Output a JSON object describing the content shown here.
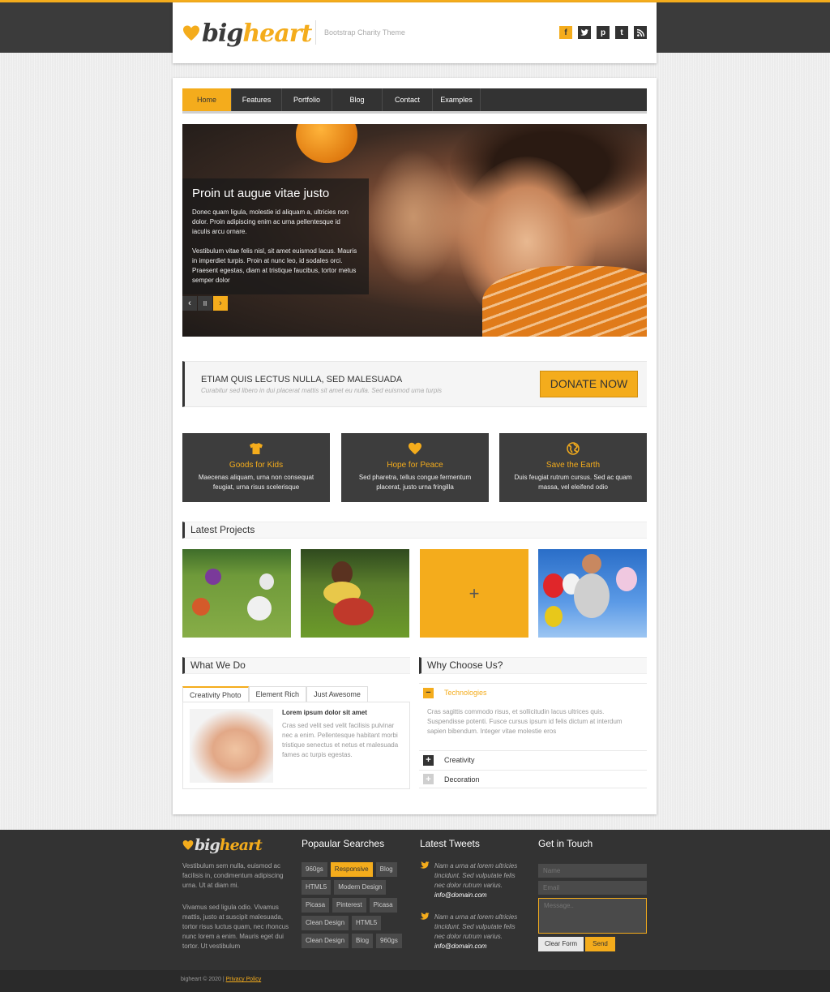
{
  "header": {
    "logo_big": "big",
    "logo_heart": "heart",
    "tagline": "Bootstrap Charity Theme",
    "social": [
      {
        "icon": "facebook-icon",
        "glyph": "f"
      },
      {
        "icon": "twitter-icon",
        "glyph": "t"
      },
      {
        "icon": "pinterest-icon",
        "glyph": "p"
      },
      {
        "icon": "tumblr-icon",
        "glyph": "t"
      },
      {
        "icon": "rss-icon",
        "glyph": ")"
      }
    ]
  },
  "nav": {
    "items": [
      "Home",
      "Features",
      "Portfolio",
      "Blog",
      "Contact",
      "Examples"
    ],
    "active": "Home"
  },
  "slider": {
    "title": "Proin ut augue vitae justo",
    "p1": "Donec quam ligula, molestie id aliquam a, ultricies non dolor. Proin adipiscing enim ac urna pellentesque id iaculis arcu ornare.",
    "p2": "Vestibulum vitae felis nisl, sit amet euismod lacus. Mauris in imperdiet turpis. Proin at nunc leo, id sodales orci. Praesent egestas, diam at tristique faucibus, tortor metus semper dolor",
    "prev": "‹",
    "pause": "II",
    "next": "›"
  },
  "cta": {
    "heading": "ETIAM QUIS LECTUS NULLA, SED MALESUADA",
    "sub": "Curabitur sed libero in dui placerat mattis sit amet eu nulla. Sed euismod urna turpis",
    "button": "DONATE NOW"
  },
  "features": [
    {
      "icon": "tshirt-icon",
      "glyph": "👕",
      "title": "Goods for Kids",
      "desc": "Maecenas aliquam, urna non consequat feugiat, urna risus scelerisque"
    },
    {
      "icon": "heart-icon",
      "glyph": "♥",
      "title": "Hope for Peace",
      "desc": "Sed pharetra, tellus congue fermentum placerat, justo urna fringilla"
    },
    {
      "icon": "globe-icon",
      "glyph": "◍",
      "title": "Save the Earth",
      "desc": "Duis feugiat rutrum cursus. Sed ac quam massa, vel eleifend odio"
    }
  ],
  "latest_projects": {
    "title": "Latest Projects",
    "plus": "+"
  },
  "what_we_do": {
    "title": "What We Do",
    "tabs": [
      "Creativity Photo",
      "Element Rich",
      "Just Awesome"
    ],
    "active_tab": "Creativity Photo",
    "heading": "Lorem ipsum dolor sit amet",
    "text": "Cras sed velit sed velit facilisis pulvinar nec a enim. Pellentesque habitant morbi tristique senectus et netus et malesuada fames ac turpis egestas."
  },
  "why_choose": {
    "title": "Why Choose Us?",
    "items": [
      {
        "label": "Technologies",
        "state": "open",
        "glyph": "−"
      },
      {
        "label": "Creativity",
        "state": "closed",
        "glyph": "+"
      },
      {
        "label": "Decoration",
        "state": "disabled",
        "glyph": "+"
      }
    ],
    "open_text": "Cras sagittis commodo risus, et sollicitudin lacus ultrices quis. Suspendisse potenti. Fusce cursus ipsum id felis dictum at interdum sapien bibendum. Integer vitae molestie eros"
  },
  "footer": {
    "about_p1": "Vestibulum sem nulla, euismod ac facilisis in, condimentum adipiscing urna. Ut at diam mi.",
    "about_p2": "Vivamus sed ligula odio. Vivamus mattis, justo at suscipit malesuada, tortor risus luctus quam, nec rhoncus nunc lorem a enim. Mauris eget dui tortor. Ut vestibulum",
    "searches_title": "Popaular Searches",
    "tags": [
      "960gs",
      "Responsive",
      "Blog",
      "HTML5",
      "Modern Design",
      "Picasa",
      "Pinterest",
      "Picasa",
      "Clean Design",
      "HTML5",
      "Clean Design",
      "Blog",
      "960gs"
    ],
    "active_tag": "Responsive",
    "tweets_title": "Latest Tweets",
    "tweets": [
      {
        "text": "Nam a urna at lorem ultricies tincidunt. Sed vulputate felis nec dolor rutrum varius.",
        "mail": "info@domain.com"
      },
      {
        "text": "Nam a urna at lorem ultricies tincidunt. Sed vulputate felis nec dolor rutrum varius.",
        "mail": "info@domain.com"
      }
    ],
    "contact_title": "Get in Touch",
    "name_placeholder": "Name",
    "email_placeholder": "Email",
    "message_placeholder": "Message..",
    "clear_label": "Clear Form",
    "send_label": "Send"
  },
  "bottom": {
    "copyright": "bigheart  ©  2020  |  ",
    "privacy": "Privacy Policy"
  },
  "colors": {
    "accent": "#f4ac1c",
    "dark": "#333333"
  }
}
